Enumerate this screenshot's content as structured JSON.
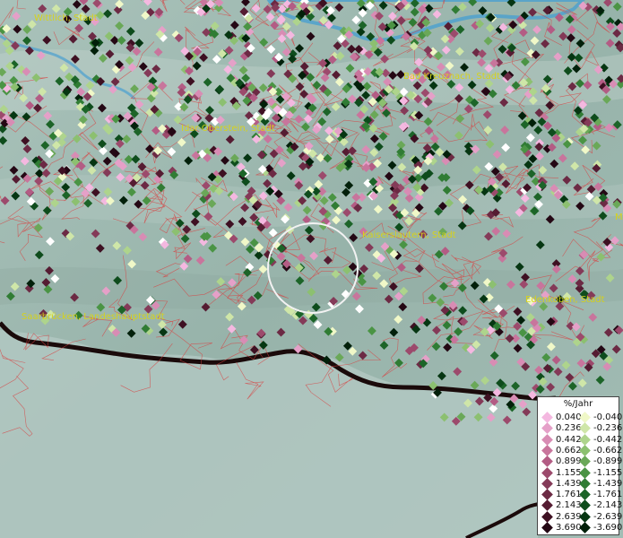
{
  "places": [
    {
      "id": "wittlich",
      "label": "Wittlich, Stadt"
    },
    {
      "id": "bad-kreuznach",
      "label": "Bad Kreuznach, Stadt"
    },
    {
      "id": "idar-oberstein",
      "label": "Idar-Oberstein, Stadt"
    },
    {
      "id": "kaiserslautern",
      "label": "Kaiserslautern, Stadt"
    },
    {
      "id": "edenkoben",
      "label": "Edenkoben, Stadt"
    },
    {
      "id": "saarbruecken",
      "label": "Saarbrücken, Landeshauptstadt"
    },
    {
      "id": "edge",
      "label": "M"
    }
  ],
  "legend": {
    "title": "%/Jahr",
    "positive": [
      {
        "value": "0.040",
        "color": "#f4b8e0"
      },
      {
        "value": "0.236",
        "color": "#e5a0c8"
      },
      {
        "value": "0.442",
        "color": "#d88cb4"
      },
      {
        "value": "0.662",
        "color": "#c8759c"
      },
      {
        "value": "0.899",
        "color": "#b35c84"
      },
      {
        "value": "1.155",
        "color": "#9c4a6c"
      },
      {
        "value": "1.439",
        "color": "#843a58"
      },
      {
        "value": "1.761",
        "color": "#6c2a44"
      },
      {
        "value": "2.143",
        "color": "#551c32"
      },
      {
        "value": "2.639",
        "color": "#3e1022"
      },
      {
        "value": "3.690",
        "color": "#240814"
      }
    ],
    "negative": [
      {
        "value": "-0.040",
        "color": "#f0f8c8"
      },
      {
        "value": "-0.236",
        "color": "#cfe6a8"
      },
      {
        "value": "-0.442",
        "color": "#aed48c"
      },
      {
        "value": "-0.662",
        "color": "#8cc070"
      },
      {
        "value": "-0.899",
        "color": "#6aa858"
      },
      {
        "value": "-1.155",
        "color": "#4a9444"
      },
      {
        "value": "-1.439",
        "color": "#307c34"
      },
      {
        "value": "-1.761",
        "color": "#1c6428"
      },
      {
        "value": "-2.143",
        "color": "#0e4c1c"
      },
      {
        "value": "-2.639",
        "color": "#063612"
      },
      {
        "value": "-3.690",
        "color": "#02200a"
      }
    ]
  },
  "colors": {
    "boundary": "#d84040",
    "label": "#d6d21c",
    "border": "#1a0a0a",
    "water": "#4aa0d0"
  }
}
